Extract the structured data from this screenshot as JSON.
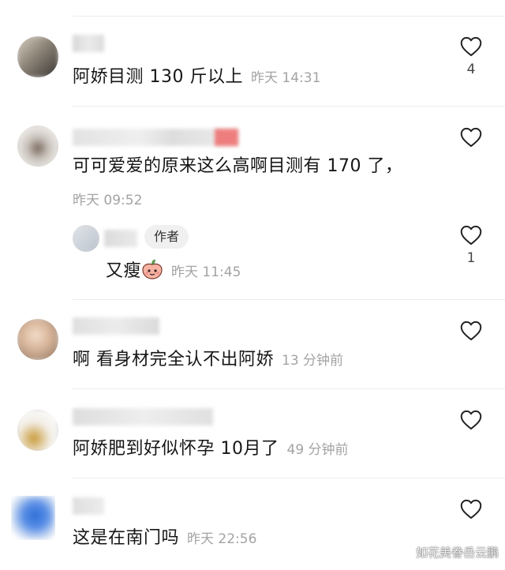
{
  "comments": [
    {
      "text": "阿娇目测 130 斤以上",
      "time": "昨天 14:31",
      "likes": "4"
    },
    {
      "text": "可可爱爱的原来这么高啊目测有 170 了，",
      "time": "昨天 09:52",
      "likes": ""
    },
    {
      "text": "又瘦",
      "time": "昨天 11:45",
      "likes": "1",
      "badge": "作者",
      "emoji": "peach-face-emoji"
    },
    {
      "text": "啊 看身材完全认不出阿娇",
      "time": "13 分钟前",
      "likes": ""
    },
    {
      "text": "阿娇肥到好似怀孕 10月了",
      "time": "49 分钟前",
      "likes": ""
    },
    {
      "text": "这是在南门吗",
      "time": "昨天 22:56",
      "likes": ""
    }
  ],
  "watermark": "如花美眷岳云鹏",
  "icons": {
    "like": "heart-outline-icon"
  },
  "colors": {
    "text": "#161616",
    "meta": "#a3a3a3",
    "divider": "#ececec",
    "accent": "#f05a5a"
  }
}
